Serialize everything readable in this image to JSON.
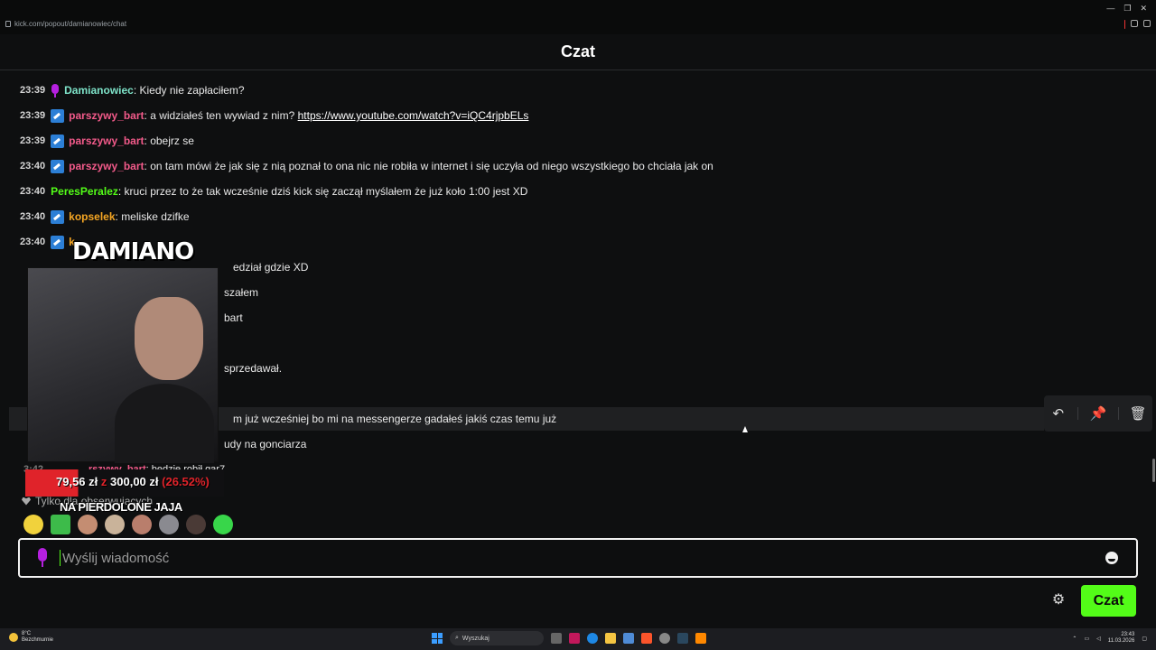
{
  "browser": {
    "url": "kick.com/popout/damianowiec/chat",
    "window_controls": [
      "—",
      "❐",
      "✕"
    ]
  },
  "header": {
    "title": "Czat"
  },
  "messages": [
    {
      "time": "23:39",
      "badge": "mic-icon",
      "user": "Damianowiec",
      "user_color": "#7ee3c9",
      "text": "Kiedy nie zapłaciłem?"
    },
    {
      "time": "23:39",
      "badge": "verified-icon",
      "user": "parszywy_bart",
      "user_color": "#f25a8a",
      "text": "a widziałeś ten wywiad z nim?",
      "link": "https://www.youtube.com/watch?v=iQC4rjpbELs"
    },
    {
      "time": "23:39",
      "badge": "verified-icon",
      "user": "parszywy_bart",
      "user_color": "#f25a8a",
      "text": "obejrz se"
    },
    {
      "time": "23:40",
      "badge": "verified-icon",
      "user": "parszywy_bart",
      "user_color": "#f25a8a",
      "text": "on tam mówi że jak się z nią poznał to ona nic nie robiła w internet i się uczyła od niego wszystkiego bo chciała jak on"
    },
    {
      "time": "23:40",
      "badge": "",
      "user": "PeresPeralez",
      "user_color": "#53fc18",
      "text": "kruci przez to że tak wcześnie dziś kick się zaczął myślałem że już koło 1:00 jest XD"
    },
    {
      "time": "23:40",
      "badge": "verified-icon",
      "user": "kopselek",
      "user_color": "#f5a623",
      "text": "meliske dzifke"
    },
    {
      "time": "23:40",
      "badge": "verified-icon",
      "user": "k",
      "user_color": "#f5a623",
      "text": ""
    },
    {
      "partial": "edział gdzie XD"
    },
    {
      "partial": "szałem"
    },
    {
      "partial": "bart"
    },
    {
      "partial": ""
    },
    {
      "partial": "sprzedawał."
    },
    {
      "partial": ""
    },
    {
      "partial": "m już wcześniej bo mi na messengerze gadałeś jakiś czas temu już"
    },
    {
      "partial": "udy na gonciarza"
    },
    {
      "partial": "3:42",
      "user": "rszywy_bart",
      "user_color": "#f25a8a",
      "text": "będzie robił gar7"
    }
  ],
  "message_actions": {
    "reply_icon": "↶",
    "pin_icon": "📌",
    "delete_icon": "🗑"
  },
  "followers_only": "Tylko dla obserwujących",
  "emotes": [
    "emote-yellow-face",
    "emote-green-frog",
    "emote-man",
    "emote-cat",
    "emote-face",
    "emote-rat",
    "emote-dark-face",
    "emote-green-blob"
  ],
  "overlay": {
    "streamer_name": "DAMIANO",
    "goal_current": "79,56 zł",
    "goal_separator": "z",
    "goal_target": "300,00 zł",
    "goal_percent": "(26.52%)",
    "goal_fraction": 0.2652,
    "tagline": "NA PIERDOLONE JAJA"
  },
  "input": {
    "placeholder": "Wyślij wiadomość"
  },
  "send_button": "Czat",
  "taskbar": {
    "weather_temp": "8°C",
    "weather_desc": "Bezchmurnie",
    "search_label": "Wyszukaj",
    "time": "23:43",
    "date": "11.03.2026"
  },
  "colors": {
    "accent": "#53fc18",
    "mic": "#b620e0",
    "verified": "#2c7fd6"
  }
}
